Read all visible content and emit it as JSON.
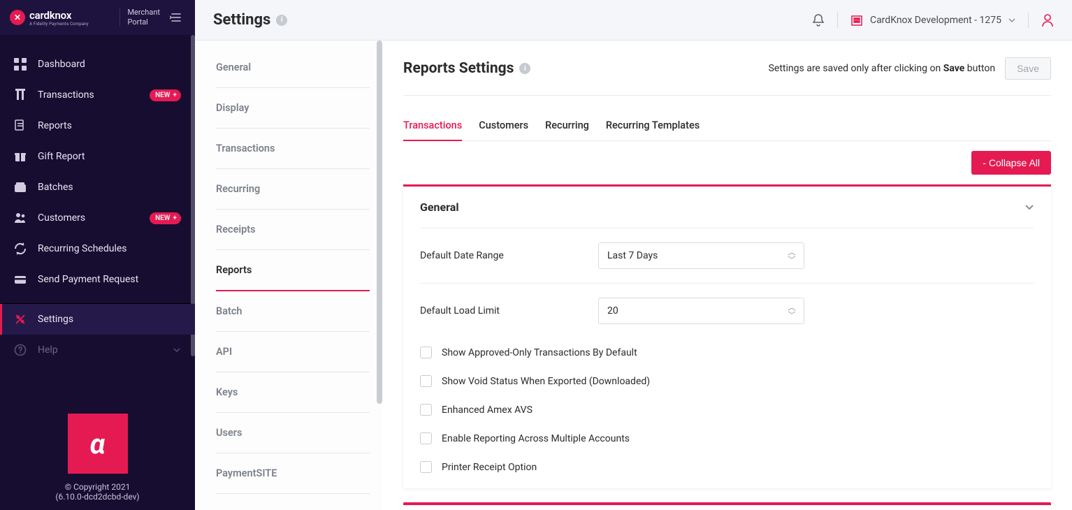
{
  "brand": {
    "name": "cardknox",
    "tagline": "A Fidelity Payments Company",
    "portal": "Merchant\nPortal"
  },
  "sidebar": {
    "items": [
      {
        "label": "Dashboard"
      },
      {
        "label": "Transactions",
        "badge": "NEW"
      },
      {
        "label": "Reports"
      },
      {
        "label": "Gift Report"
      },
      {
        "label": "Batches"
      },
      {
        "label": "Customers",
        "badge": "NEW"
      },
      {
        "label": "Recurring Schedules"
      },
      {
        "label": "Send Payment Request"
      },
      {
        "label": "Settings"
      },
      {
        "label": "Help"
      }
    ],
    "copyright": "© Copyright 2021",
    "version": "(6.10.0-dcd2dcbd-dev)"
  },
  "header": {
    "title": "Settings",
    "org": "CardKnox Development - 1275"
  },
  "settingsNav": {
    "items": [
      {
        "label": "General"
      },
      {
        "label": "Display"
      },
      {
        "label": "Transactions"
      },
      {
        "label": "Recurring"
      },
      {
        "label": "Receipts"
      },
      {
        "label": "Reports"
      },
      {
        "label": "Batch"
      },
      {
        "label": "API"
      },
      {
        "label": "Keys"
      },
      {
        "label": "Users"
      },
      {
        "label": "PaymentSITE"
      }
    ]
  },
  "content": {
    "title": "Reports Settings",
    "saveHintPrefix": "Settings are saved only after clicking on ",
    "saveHintBold": "Save",
    "saveHintSuffix": " button",
    "saveBtn": "Save",
    "tabs": [
      {
        "label": "Transactions"
      },
      {
        "label": "Customers"
      },
      {
        "label": "Recurring"
      },
      {
        "label": "Recurring Templates"
      }
    ],
    "collapseAll": "- Collapse All",
    "panel": {
      "title": "General",
      "defaultDateRange": {
        "label": "Default Date Range",
        "value": "Last 7 Days"
      },
      "defaultLoadLimit": {
        "label": "Default Load Limit",
        "value": "20"
      },
      "checks": [
        {
          "label": "Show Approved-Only Transactions By Default"
        },
        {
          "label": "Show Void Status When Exported (Downloaded)"
        },
        {
          "label": "Enhanced Amex AVS"
        },
        {
          "label": "Enable Reporting Across Multiple Accounts"
        },
        {
          "label": "Printer Receipt Option"
        }
      ]
    }
  }
}
